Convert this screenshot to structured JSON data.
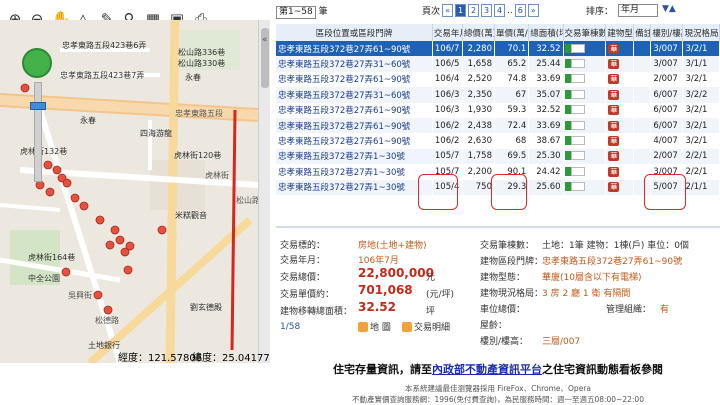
{
  "toolbar": {
    "tools": [
      "zoom-in-icon",
      "zoom-out-icon",
      "pan-hand-icon",
      "measure-triangle-icon",
      "ruler-icon",
      "poi-icon",
      "grid-icon",
      "color-palette-icon",
      "print-icon"
    ],
    "glyphs": [
      "⊕",
      "⊖",
      "✋",
      "△",
      "✎",
      "⚲",
      "▦",
      "▣",
      "⎙"
    ]
  },
  "map": {
    "labels": [
      {
        "text": "忠孝東路五段423巷6弄",
        "cls": ""
      },
      {
        "text": "松山路336巷",
        "cls": ""
      },
      {
        "text": "松山路330巷",
        "cls": ""
      },
      {
        "text": "忠孝東路五段423巷7弄",
        "cls": ""
      },
      {
        "text": "永春",
        "cls": ""
      },
      {
        "text": "忠孝東路五段",
        "cls": "road"
      },
      {
        "text": "永春",
        "cls": ""
      },
      {
        "text": "四海游龍",
        "cls": ""
      },
      {
        "text": "虎林街132巷",
        "cls": ""
      },
      {
        "text": "虎林街120巷",
        "cls": ""
      },
      {
        "text": "虎林街",
        "cls": "road"
      },
      {
        "text": "米糕觀音",
        "cls": ""
      },
      {
        "text": "中全公園",
        "cls": ""
      },
      {
        "text": "虎林街164巷",
        "cls": ""
      },
      {
        "text": "吳興街",
        "cls": "road"
      },
      {
        "text": "松德路",
        "cls": "road"
      },
      {
        "text": "土地銀行",
        "cls": ""
      },
      {
        "text": "劉玄德殿",
        "cls": ""
      },
      {
        "text": "松山路",
        "cls": "road"
      }
    ],
    "coord_x": "經度：121.57806",
    "coord_y": "緯度：25.04177",
    "collapse": "«"
  },
  "topbar": {
    "page_select": "第1~58",
    "page_suffix": "筆",
    "page_label": "頁次",
    "pages": [
      "«",
      "1",
      "2",
      "3",
      "4",
      "..",
      "6",
      "»"
    ],
    "sort_label": "排序：",
    "sort_value": "年月",
    "sort_arrows": "▼▲"
  },
  "table": {
    "headers": [
      "區段位置或區段門牌",
      "交易年月",
      "總價(萬)",
      "單價(萬/坪)",
      "總面積(坪)",
      "交易筆棟數",
      "建物型態",
      "備註",
      "樓別/樓高",
      "現況格局房/廳/衛"
    ],
    "rows": [
      {
        "addr": "忠孝東路五段372巷27弄61~90號",
        "ym": "106/7",
        "total": "2,280",
        "unit": "70.1",
        "area": "32.52",
        "mk": "華",
        "floor": "3/007",
        "layout": "3/2/1",
        "sel": true
      },
      {
        "addr": "忠孝東路五段372巷27弄31~60號",
        "ym": "106/5",
        "total": "1,658",
        "unit": "65.2",
        "area": "25.44",
        "mk": "華",
        "floor": "3/007",
        "layout": "3/1/1",
        "sel": false
      },
      {
        "addr": "忠孝東路五段372巷27弄61~90號",
        "ym": "106/4",
        "total": "2,520",
        "unit": "74.8",
        "area": "33.69",
        "mk": "華",
        "floor": "2/007",
        "layout": "3/2/1",
        "sel": false
      },
      {
        "addr": "忠孝東路五段372巷27弄31~60號",
        "ym": "106/3",
        "total": "2,350",
        "unit": "67",
        "area": "35.07",
        "mk": "華",
        "floor": "6/007",
        "layout": "3/2/2",
        "sel": false
      },
      {
        "addr": "忠孝東路五段372巷27弄61~90號",
        "ym": "106/3",
        "total": "1,930",
        "unit": "59.3",
        "area": "32.52",
        "mk": "華",
        "floor": "6/007",
        "layout": "3/2/1",
        "sel": false
      },
      {
        "addr": "忠孝東路五段372巷27弄61~90號",
        "ym": "106/2",
        "total": "2,438",
        "unit": "72.4",
        "area": "33.69",
        "mk": "華",
        "floor": "6/007",
        "layout": "3/2/1",
        "sel": false
      },
      {
        "addr": "忠孝東路五段372巷27弄61~90號",
        "ym": "106/2",
        "total": "2,630",
        "unit": "68",
        "area": "38.67",
        "mk": "華",
        "floor": "4/007",
        "layout": "3/2/1",
        "sel": false
      },
      {
        "addr": "忠孝東路五段372巷27弄1~30號",
        "ym": "105/7",
        "total": "1,758",
        "unit": "69.5",
        "area": "25.30",
        "mk": "華",
        "floor": "2/007",
        "layout": "2/2/1",
        "sel": false
      },
      {
        "addr": "忠孝東路五段372巷27弄1~30號",
        "ym": "105/7",
        "total": "2,200",
        "unit": "90.1",
        "area": "24.42",
        "mk": "華",
        "floor": "3/007",
        "layout": "2/2/1",
        "sel": false
      },
      {
        "addr": "忠孝東路五段372巷27弄1~30號",
        "ym": "105/4",
        "total": "750",
        "unit": "29.3",
        "area": "25.60",
        "mk": "華",
        "floor": "5/007",
        "layout": "2/1/1",
        "sel": false
      }
    ]
  },
  "detail": {
    "l_name": "交易標的：",
    "v_name": "房地(土地+建物)",
    "l_ym": "交易年月：",
    "v_ym": "106年7月",
    "l_total": "交易總價：",
    "v_total": "22,800,000",
    "u_total": "元",
    "l_unit": "交易單價約：",
    "v_unit": "701,068",
    "u_unit": "(元/坪)",
    "l_area": "建物移轉總面積：",
    "v_area": "32.52",
    "u_area": "坪",
    "l_count": "交易筆棟數：",
    "v_count": "土地：1筆 建物：1棟(戶) 車位：0個",
    "l_addr": "建物區段門牌：",
    "v_addr": "忠孝東路五段372巷27弄61~90號",
    "l_type": "建物型態：",
    "v_type": "華廈(10層含以下有電梯)",
    "l_layout": "建物現況格局：",
    "v_layout": "3 房 2 廳 1 衛 有隔間",
    "l_park": "車位總價：",
    "l_mgmt": "管理組織：",
    "v_mgmt": "有",
    "l_remark": "屋齡：",
    "l_floor": "樓別/樓高：",
    "v_floor": "三層/007",
    "page": "1/58",
    "btn_map": "地 圖",
    "btn_info": "交易明細"
  },
  "footer": {
    "pre": "住宅存量資訊，請至",
    "link": "內政部不動產資訊平台",
    "post": "之住宅資訊動態看板參閱",
    "browser": "本系統建議最佳瀏覽器採用 FireFox、Chrome、Opera",
    "service": "不動產實價查詢服務網：1996(免付費查詢)，為民服務時間：週一至週五08:00~22:00"
  }
}
